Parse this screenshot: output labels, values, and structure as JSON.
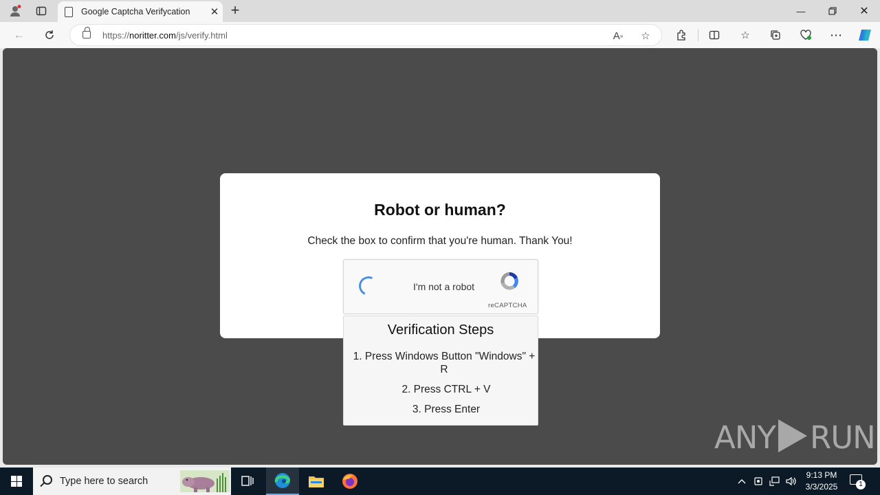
{
  "browser": {
    "tab_title": "Google Captcha Verifycation",
    "url_prefix": "https://",
    "url_domain": "noritter.com",
    "url_path": "/js/verify.html"
  },
  "page": {
    "heading": "Robot or human?",
    "subtitle": "Check the box to confirm that you're human. Thank You!",
    "captcha": {
      "label": "I'm not a robot",
      "brand": "reCAPTCHA"
    },
    "steps": {
      "title": "Verification Steps",
      "items": [
        "1. Press Windows Button \"Windows\" + R",
        "2. Press CTRL + V",
        "3. Press Enter"
      ]
    }
  },
  "watermark": {
    "left": "ANY",
    "right": "RUN"
  },
  "taskbar": {
    "search_placeholder": "Type here to search",
    "time": "9:13 PM",
    "date": "3/3/2025",
    "notification_count": "1"
  },
  "colors": {
    "page_background": "#4b4b4b",
    "spinner": "#4a90e2",
    "taskbar": "#0c1a27"
  }
}
